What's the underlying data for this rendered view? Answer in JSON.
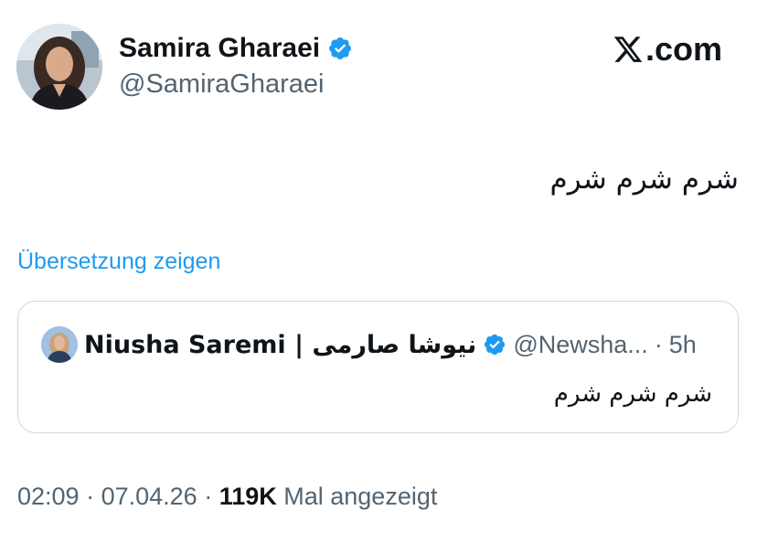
{
  "author": {
    "display_name": "Samira Gharaei",
    "handle": "@SamiraGharaei",
    "verified": true,
    "avatar_icon": "profile-photo"
  },
  "brand": {
    "icon": "x-logo-icon",
    "suffix": ".com"
  },
  "tweet": {
    "text": "شرم شرم شرم",
    "translate_label": "Übersetzung zeigen"
  },
  "quoted_tweet": {
    "display_name": "Niusha Saremi | نیوشا صارمی",
    "verified": true,
    "handle": "@Newsha...",
    "separator": "·",
    "time": "5h",
    "text": "شرم شرم شرم"
  },
  "meta": {
    "time": "02:09",
    "sep1": " · ",
    "date": "07.04.26",
    "sep2": " · ",
    "views_count": "119K",
    "views_label": " Mal angezeigt"
  },
  "colors": {
    "link": "#1d9bf0",
    "verified": "#1d9bf0",
    "secondary_text": "#536471",
    "border": "#cfd9de"
  }
}
